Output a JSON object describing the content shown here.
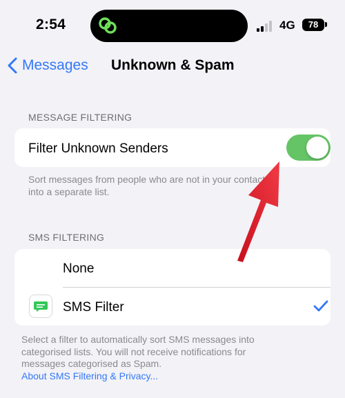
{
  "status_bar": {
    "time": "2:54",
    "network": "4G",
    "battery": "78"
  },
  "nav": {
    "back_label": "Messages",
    "title": "Unknown & Spam"
  },
  "message_filtering": {
    "header": "MESSAGE FILTERING",
    "filter_unknown_label": "Filter Unknown Senders",
    "filter_unknown_on": true,
    "footnote_line1": "Sort messages from people who are not in your contacts",
    "footnote_line2": "into a separate list."
  },
  "sms_filtering": {
    "header": "SMS FILTERING",
    "options": [
      {
        "label": "None",
        "selected": false
      },
      {
        "label": "SMS Filter",
        "selected": true
      }
    ],
    "footnote_line1": "Select a filter to automatically sort SMS messages into",
    "footnote_line2": "categorised lists. You will not receive notifications for",
    "footnote_line3": "messages categorised as Spam.",
    "link": "About SMS Filtering & Privacy..."
  },
  "colors": {
    "accent": "#3478f6",
    "toggle_on": "#65c466",
    "annotation_arrow": "#e0242f"
  }
}
